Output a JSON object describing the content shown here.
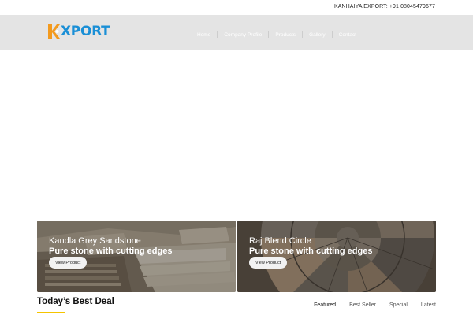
{
  "topbar": {
    "contact_text": "KANHAIYA EXPORT: +91 08045479677"
  },
  "header": {
    "logo_word": "XPORT",
    "nav": [
      {
        "label": "Home"
      },
      {
        "label": "Company Profile"
      },
      {
        "label": "Products"
      },
      {
        "label": "Gallery"
      },
      {
        "label": "Contact"
      }
    ]
  },
  "banners": [
    {
      "title": "Kandla Grey Sandstone",
      "tagline": "Pure stone with cutting edges",
      "button": "View Product"
    },
    {
      "title": "Raj Blend Circle",
      "tagline": "Pure stone with cutting edges",
      "button": "View Product"
    }
  ],
  "deal": {
    "heading": "Today’s Best Deal",
    "tabs": [
      {
        "label": "Featured",
        "active": true
      },
      {
        "label": "Best Seller",
        "active": false
      },
      {
        "label": "Special",
        "active": false
      },
      {
        "label": "Latest",
        "active": false
      }
    ]
  },
  "colors": {
    "brand_blue": "#1a8fd6",
    "brand_orange": "#f39a1e",
    "accent_yellow": "#f5c400",
    "header_bg": "#e4e4e4"
  }
}
